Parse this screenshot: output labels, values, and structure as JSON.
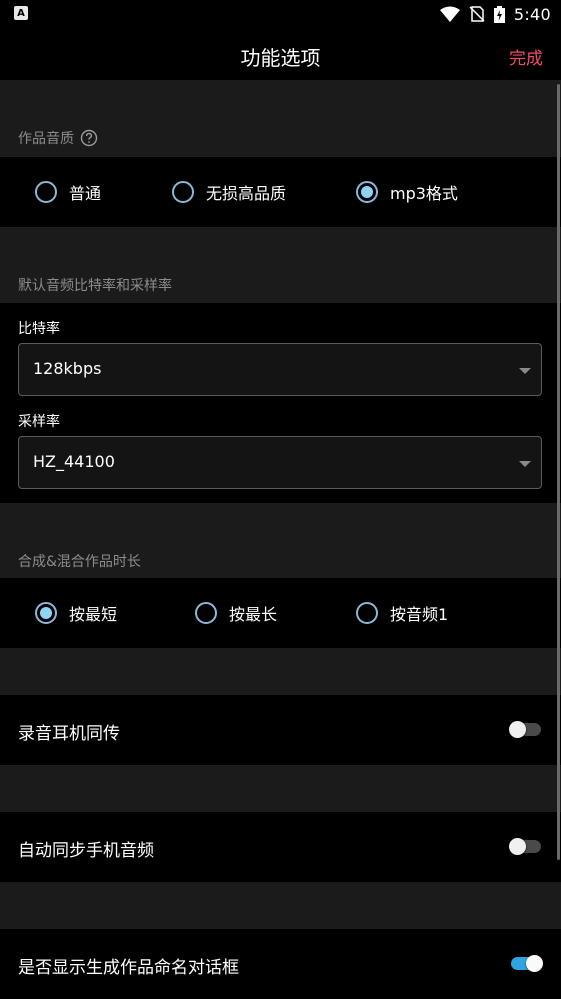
{
  "status_bar": {
    "left_icon_letter": "A",
    "time": "5:40",
    "icons": [
      "wifi-icon",
      "no-sim-icon",
      "battery-charging-icon"
    ]
  },
  "header": {
    "title": "功能选项",
    "done_label": "完成",
    "accent_color": "#f14a67"
  },
  "quality": {
    "section_label": "作品音质",
    "help_icon": "help-circle-icon",
    "options": [
      {
        "label": "普通",
        "checked": false
      },
      {
        "label": "无损高品质",
        "checked": false
      },
      {
        "label": "mp3格式",
        "checked": true
      }
    ]
  },
  "default_rates": {
    "section_label": "默认音频比特率和采样率",
    "bitrate": {
      "label": "比特率",
      "value": "128kbps"
    },
    "samplerate": {
      "label": "采样率",
      "value": "HZ_44100"
    }
  },
  "duration": {
    "section_label": "合成&混合作品时长",
    "options": [
      {
        "label": "按最短",
        "checked": true
      },
      {
        "label": "按最长",
        "checked": false
      },
      {
        "label": "按音频1",
        "checked": false
      }
    ]
  },
  "toggles": [
    {
      "label": "录音耳机同传",
      "on": false
    },
    {
      "label": "自动同步手机音频",
      "on": false
    },
    {
      "label": "是否显示生成作品命名对话框",
      "on": true
    }
  ],
  "colors": {
    "radio_checked": "#8fd3f5",
    "switch_on": "#2ea4e0",
    "section_bg": "#1b1b1b"
  }
}
